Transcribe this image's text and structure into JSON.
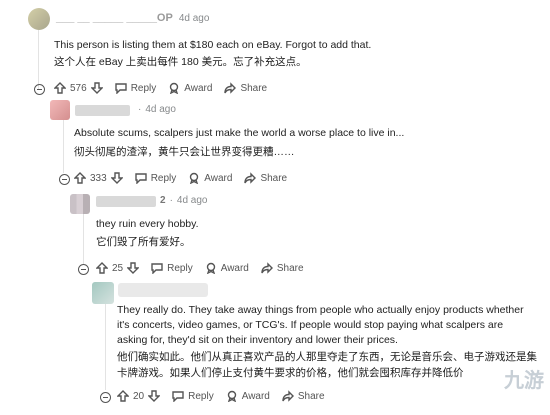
{
  "comments": [
    {
      "id": "c1",
      "username": "___ __ _____ _____OP",
      "time": "4d ago",
      "text_en": "This person is listing them at $180 each on eBay. Forgot to add that.",
      "text_zh": "这个人在 eBay 上卖出每件 180 美元。忘了补充这点。",
      "votes": "576"
    },
    {
      "id": "c2",
      "username": "",
      "time": "4d ago",
      "text_en": "Absolute scums, scalpers just make the world a worse place to live in...",
      "text_zh": "彻头彻尾的渣滓，黄牛只会让世界变得更糟……",
      "votes": "333"
    },
    {
      "id": "c3",
      "username": "2",
      "time": "4d ago",
      "text_en": "they ruin every hobby.",
      "text_zh": "它们毁了所有爱好。",
      "votes": "25"
    },
    {
      "id": "c4",
      "username": "",
      "time": "",
      "text_en": "They really do. They take away things from people who actually enjoy products whether it's concerts, video games, or TCG's. If people would stop paying what scalpers are asking for, they'd sit on their inventory and lower their prices.",
      "text_zh_1": "他们确实如此。他们从真正喜欢产品的人那里夺走了东西，无论是音乐会、电子游戏还是集换式",
      "text_zh_2": "卡牌游戏。如果人们停止支付黄牛要求的价格，他们就会囤积库存并降低价",
      "votes": "20"
    }
  ],
  "actions": {
    "reply": "Reply",
    "award": "Award",
    "share": "Share"
  },
  "watermark": "九游",
  "icons": [
    "upvote-icon",
    "downvote-icon",
    "reply-icon",
    "award-icon",
    "share-icon",
    "collapse-icon"
  ]
}
